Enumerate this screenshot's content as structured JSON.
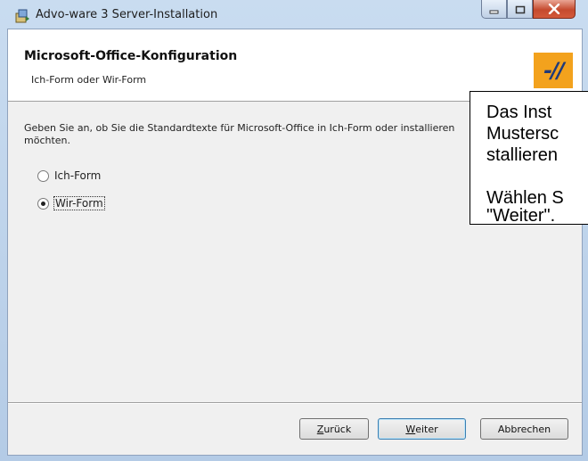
{
  "window": {
    "title": "Advo-ware 3 Server-Installation"
  },
  "header": {
    "title": "Microsoft-Office-Konfiguration",
    "subtitle": "Ich-Form oder Wir-Form",
    "logo_text": "-//",
    "logo_color": "#f3a21d"
  },
  "body": {
    "description": "Geben Sie an, ob Sie die Standardtexte für Microsoft-Office in Ich-Form oder installieren möchten.",
    "options": [
      {
        "label": "Ich-Form",
        "selected": false
      },
      {
        "label": "Wir-Form",
        "selected": true
      }
    ]
  },
  "note": {
    "lines": [
      "Das Inst",
      "Mustersc",
      "stallieren",
      "",
      "Wählen S",
      "\"Weiter\"."
    ]
  },
  "buttons": {
    "back": {
      "mnemonic": "Z",
      "rest": "urück"
    },
    "next": {
      "mnemonic": "W",
      "rest": "eiter"
    },
    "cancel": "Abbrechen"
  },
  "icons": {
    "app": "installer-icon",
    "minimize": "minimize-icon",
    "maximize": "maximize-icon",
    "close": "close-icon"
  }
}
